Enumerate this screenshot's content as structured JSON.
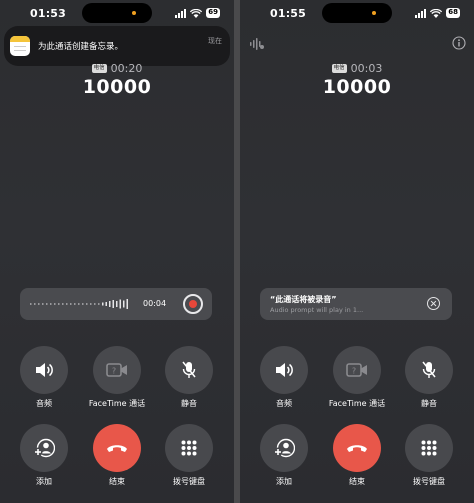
{
  "phones": [
    {
      "status_time": "01:53",
      "battery": "69",
      "notification": {
        "text": "为此通话创建备忘录。",
        "time": "现在",
        "icon": "notes-app-icon"
      },
      "carrier_badge": "电信",
      "call_timer": "00:20",
      "number": "10000",
      "recording": {
        "elapsed": "00:04"
      },
      "controls": [
        {
          "label": "音频",
          "icon": "speaker-icon"
        },
        {
          "label": "FaceTime 通话",
          "icon": "facetime-icon"
        },
        {
          "label": "静音",
          "icon": "mute-icon"
        },
        {
          "label": "添加",
          "icon": "add-contact-icon"
        },
        {
          "label": "结束",
          "icon": "end-call-icon"
        },
        {
          "label": "拨号键盘",
          "icon": "keypad-icon"
        }
      ]
    },
    {
      "status_time": "01:55",
      "battery": "68",
      "carrier_badge": "电信",
      "call_timer": "00:03",
      "number": "10000",
      "alert": {
        "title": "“此通话将被录音”",
        "subtitle": "Audio prompt will play in 1..."
      },
      "controls": [
        {
          "label": "音频",
          "icon": "speaker-icon"
        },
        {
          "label": "FaceTime 通话",
          "icon": "facetime-icon"
        },
        {
          "label": "静音",
          "icon": "mute-icon"
        },
        {
          "label": "添加",
          "icon": "add-contact-icon"
        },
        {
          "label": "结束",
          "icon": "end-call-icon"
        },
        {
          "label": "拨号键盘",
          "icon": "keypad-icon"
        }
      ]
    }
  ],
  "colors": {
    "background": "#2e2f33",
    "control_button": "#48494d",
    "end_call": "#e8574a",
    "record_dot": "#e8473a",
    "card": "#4a4b4f",
    "notification_bg": "#1a1a1c"
  }
}
